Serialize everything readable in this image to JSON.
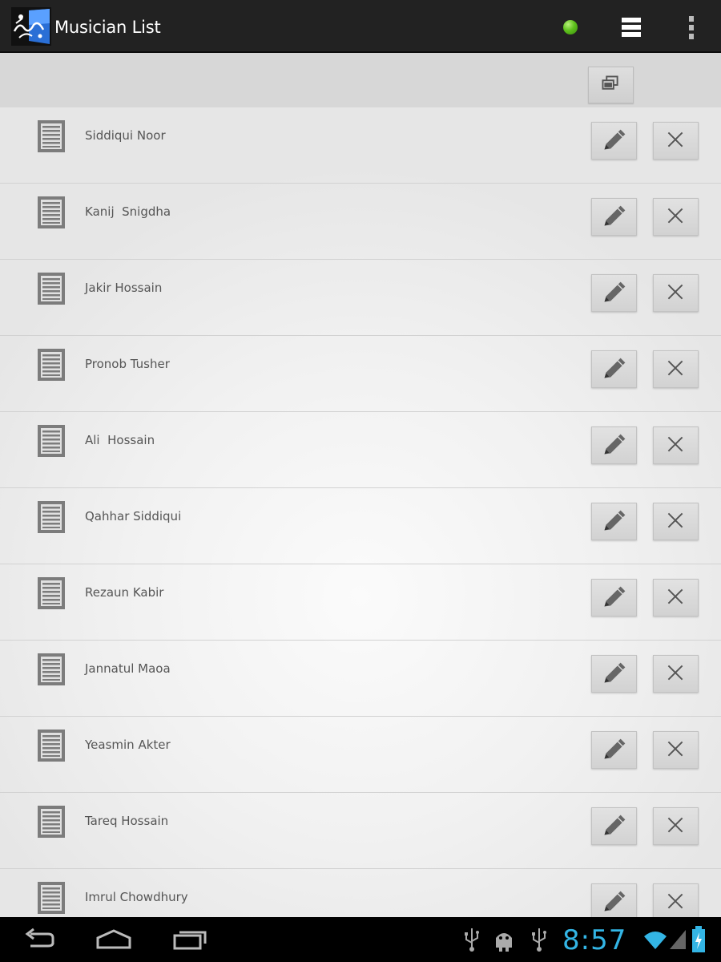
{
  "app": {
    "title": "Musician List",
    "accent_color": "#33b5e5",
    "status_color": "#5fc21d"
  },
  "action_bar": {
    "icons": [
      "app-logo",
      "status-dot",
      "list-view-icon",
      "overflow-menu-icon"
    ]
  },
  "sub_header": {
    "icons": [
      "copy-icon"
    ]
  },
  "musicians": [
    {
      "name": "Siddiqui Noor"
    },
    {
      "name": "Kanij  Snigdha"
    },
    {
      "name": "Jakir Hossain"
    },
    {
      "name": "Pronob Tusher"
    },
    {
      "name": "Ali  Hossain"
    },
    {
      "name": "Qahhar Siddiqui"
    },
    {
      "name": "Rezaun Kabir"
    },
    {
      "name": "Jannatul Maoa"
    },
    {
      "name": "Yeasmin Akter"
    },
    {
      "name": "Tareq Hossain"
    },
    {
      "name": "Imrul Chowdhury"
    }
  ],
  "row_icons": {
    "item": "document-icon",
    "edit": "pencil-icon",
    "delete": "close-icon"
  },
  "system_bar": {
    "time": "8:57",
    "nav_icons": [
      "back-icon",
      "home-icon",
      "recent-apps-icon"
    ],
    "status_icons": [
      "usb-icon",
      "android-debug-icon",
      "usb-icon",
      "wifi-icon",
      "signal-icon",
      "battery-icon"
    ]
  }
}
